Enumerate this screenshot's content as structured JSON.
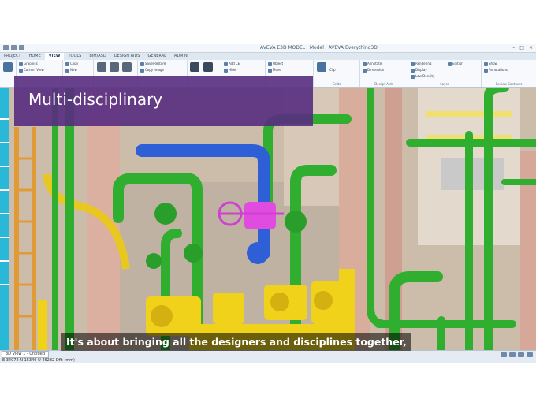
{
  "app": {
    "title": "AVEVA E3D MODEL · Model · AVEVA Everything3D",
    "tabs": [
      "PROJECT",
      "HOME",
      "VIEW",
      "TOOLS",
      "BIM/ASD",
      "DESIGN AIDS",
      "GENERAL",
      "ADMIN"
    ],
    "active_tab": "VIEW"
  },
  "ribbon": {
    "items": [
      "Graphics",
      "Current View",
      "Copy",
      "New",
      "Save/Restore",
      "Copy Image",
      "Walk",
      "Fly",
      "Restore",
      "Add CE",
      "Hide",
      "Object",
      "Move",
      "Clip",
      "Annotate",
      "Dimension",
      "Section",
      "Annotations",
      "Display",
      "Rendering",
      "Low Density",
      "Edition",
      "Show",
      "Annotations"
    ],
    "groups": [
      "Grids",
      "Design Aids",
      "Layer",
      "Review Contours"
    ]
  },
  "viewport": {
    "view_tab": "3D View 1 - Untitled",
    "coordinates": "E 34072 N 15340 U 46282 Dflt (mm)"
  },
  "overlay": {
    "heading": "Multi-disciplinary",
    "caption": "It's about bringing all the designers and disciplines together,"
  },
  "colors": {
    "banner": "#582c80",
    "pipe_green": "#2fae2f",
    "pipe_blue": "#2e5fd6",
    "equipment_yellow": "#f0d21a",
    "valve_magenta": "#e040e0",
    "steel_orange": "#e0a23c",
    "structure_pink": "#d9b1a3"
  }
}
